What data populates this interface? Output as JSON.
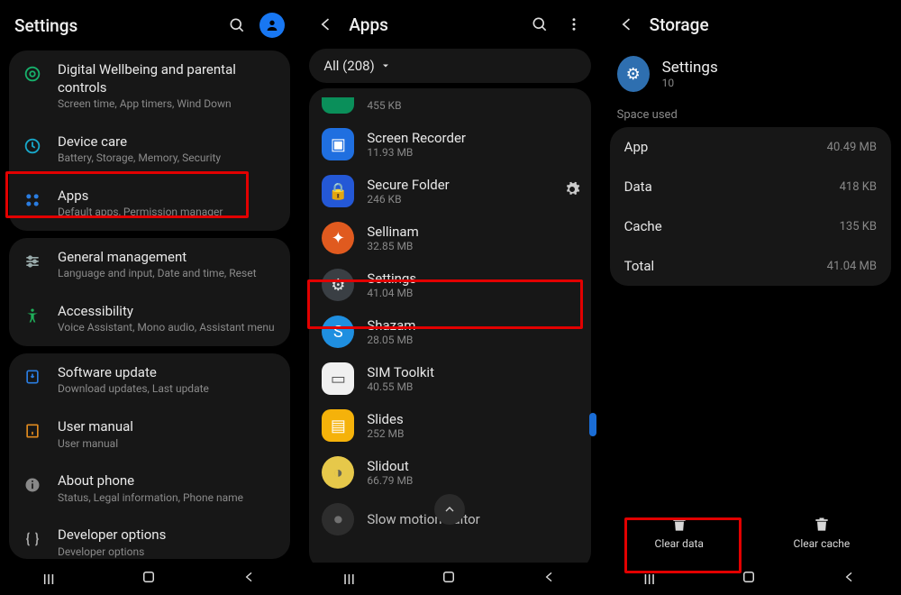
{
  "panel1": {
    "title": "Settings",
    "items": [
      {
        "title": "Digital Wellbeing and parental controls",
        "sub": "Screen time, App timers, Wind Down"
      },
      {
        "title": "Device care",
        "sub": "Battery, Storage, Memory, Security"
      },
      {
        "title": "Apps",
        "sub": "Default apps, Permission manager"
      },
      {
        "title": "General management",
        "sub": "Language and input, Date and time, Reset"
      },
      {
        "title": "Accessibility",
        "sub": "Voice Assistant, Mono audio, Assistant menu"
      },
      {
        "title": "Software update",
        "sub": "Download updates, Last update"
      },
      {
        "title": "User manual",
        "sub": "User manual"
      },
      {
        "title": "About phone",
        "sub": "Status, Legal information, Phone name"
      },
      {
        "title": "Developer options",
        "sub": "Developer options"
      }
    ]
  },
  "panel2": {
    "title": "Apps",
    "filter": "All (208)",
    "partial_top_sub": "455 KB",
    "apps": [
      {
        "title": "Screen Recorder",
        "sub": "11.93 MB",
        "color": "#1f6fe0",
        "glyph": "▣"
      },
      {
        "title": "Secure Folder",
        "sub": "246 KB",
        "color": "#2458d6",
        "glyph": "🔒",
        "gear": true
      },
      {
        "title": "Sellinam",
        "sub": "32.85 MB",
        "color": "#e05a1f",
        "glyph": "✦"
      },
      {
        "title": "Settings",
        "sub": "41.04 MB",
        "color": "#3a3f44",
        "glyph": "⚙"
      },
      {
        "title": "Shazam",
        "sub": "28.05 MB",
        "color": "#1f8fe0",
        "glyph": "S"
      },
      {
        "title": "SIM Toolkit",
        "sub": "40.55 MB",
        "color": "#f0f0f0",
        "glyph": "▭"
      },
      {
        "title": "Slides",
        "sub": "252 MB",
        "color": "#f5b20a",
        "glyph": "▤"
      },
      {
        "title": "Slidout",
        "sub": "66.79 MB",
        "color": "#e6c84a",
        "glyph": "◑"
      },
      {
        "title": "Slow motion editor",
        "sub": "",
        "color": "#333",
        "glyph": "⏺"
      }
    ]
  },
  "panel3": {
    "title": "Storage",
    "app_name": "Settings",
    "app_version": "10",
    "section": "Space used",
    "rows": [
      {
        "k": "App",
        "v": "40.49 MB"
      },
      {
        "k": "Data",
        "v": "418 KB"
      },
      {
        "k": "Cache",
        "v": "135 KB"
      },
      {
        "k": "Total",
        "v": "41.04 MB"
      }
    ],
    "clear_data": "Clear data",
    "clear_cache": "Clear cache"
  }
}
